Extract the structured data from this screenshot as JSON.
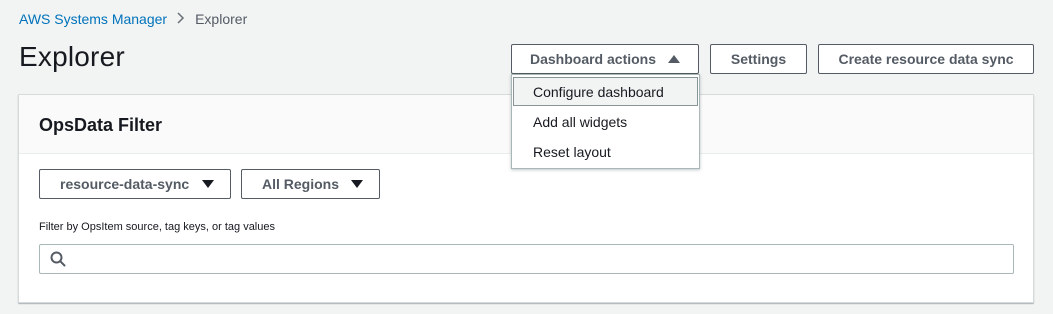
{
  "breadcrumb": {
    "root": "AWS Systems Manager",
    "current": "Explorer"
  },
  "header": {
    "title": "Explorer",
    "dashboard_actions_label": "Dashboard actions",
    "settings_label": "Settings",
    "create_sync_label": "Create resource data sync"
  },
  "dashboard_menu": {
    "items": [
      {
        "label": "Configure dashboard",
        "highlighted": true
      },
      {
        "label": "Add all widgets",
        "highlighted": false
      },
      {
        "label": "Reset layout",
        "highlighted": false
      }
    ]
  },
  "panel": {
    "title": "OpsData Filter",
    "sync_select_value": "resource-data-sync",
    "region_select_value": "All Regions",
    "filter_label": "Filter by OpsItem source, tag keys, or tag values",
    "filter_value": ""
  },
  "colors": {
    "link": "#0073bb",
    "background": "#f2f3f3",
    "button_border": "#545b64"
  },
  "icons": {
    "breadcrumb_separator": "chevron-right-icon",
    "dashboard_caret": "caret-up-icon",
    "select_caret": "caret-down-icon",
    "search": "search-icon"
  }
}
